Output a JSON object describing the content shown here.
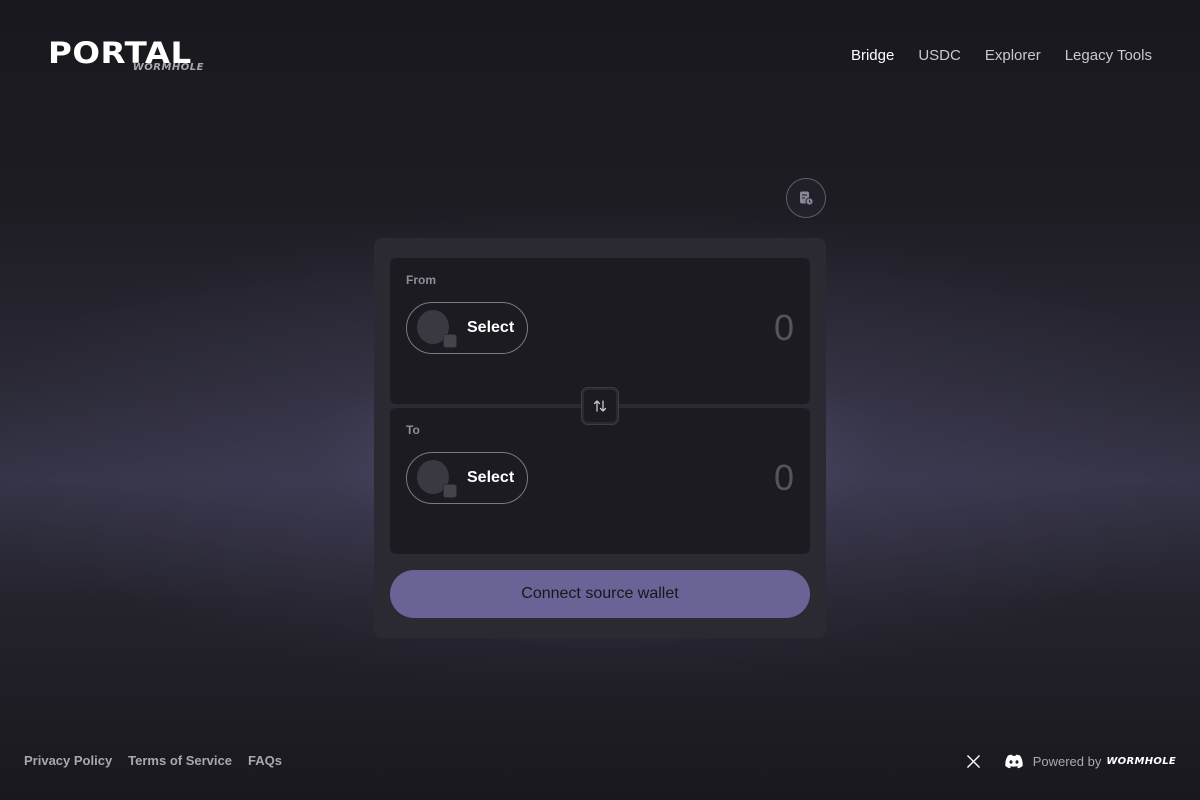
{
  "header": {
    "logo_main": "PORTAL",
    "logo_sub": "WORMHOLE",
    "nav": [
      {
        "label": "Bridge",
        "active": true
      },
      {
        "label": "USDC",
        "active": false
      },
      {
        "label": "Explorer",
        "active": false
      },
      {
        "label": "Legacy Tools",
        "active": false
      }
    ]
  },
  "bridge": {
    "settings_icon": "transaction-history-icon",
    "from": {
      "label": "From",
      "select_label": "Select",
      "amount": "0"
    },
    "swap_icon": "swap-arrows-icon",
    "to": {
      "label": "To",
      "select_label": "Select",
      "amount": "0"
    },
    "connect_label": "Connect source wallet"
  },
  "footer": {
    "links": [
      "Privacy Policy",
      "Terms of Service",
      "FAQs"
    ],
    "social": [
      "x-icon",
      "discord-icon"
    ],
    "powered_by": "Powered by",
    "powered_brand": "WORMHOLE"
  },
  "colors": {
    "background": "#1d1c23",
    "card": "#2b2a33",
    "panel": "#1c1b21",
    "accent": "#6a6496"
  }
}
